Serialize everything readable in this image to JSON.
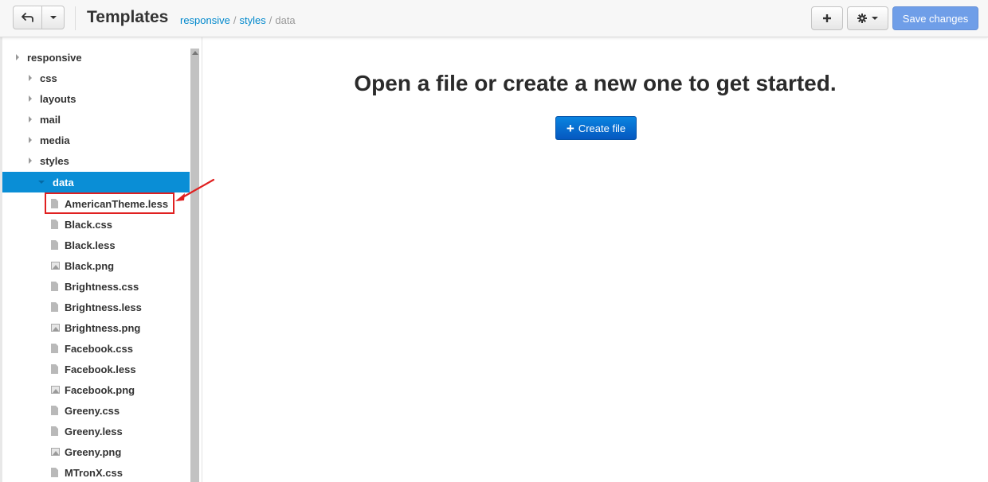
{
  "header": {
    "title": "Templates",
    "breadcrumb": [
      "responsive",
      "styles",
      "data"
    ],
    "breadcrumb_separator": "/",
    "save_label": "Save changes",
    "icons": {
      "back": "back-arrow-icon",
      "back_menu": "chevron-down-icon",
      "add": "plus-icon",
      "settings": "gear-icon",
      "settings_menu": "chevron-down-icon"
    }
  },
  "sidebar": {
    "tree": [
      {
        "label": "responsive",
        "type": "folder",
        "expanded": false
      },
      {
        "label": "css",
        "type": "folder",
        "expanded": false
      },
      {
        "label": "layouts",
        "type": "folder",
        "expanded": false
      },
      {
        "label": "mail",
        "type": "folder",
        "expanded": false
      },
      {
        "label": "media",
        "type": "folder",
        "expanded": false
      },
      {
        "label": "styles",
        "type": "folder",
        "expanded": false
      },
      {
        "label": "data",
        "type": "folder",
        "expanded": true,
        "selected": true
      },
      {
        "label": "AmericanTheme.less",
        "type": "file",
        "highlighted": true
      },
      {
        "label": "Black.css",
        "type": "file"
      },
      {
        "label": "Black.less",
        "type": "file"
      },
      {
        "label": "Black.png",
        "type": "image"
      },
      {
        "label": "Brightness.css",
        "type": "file"
      },
      {
        "label": "Brightness.less",
        "type": "file"
      },
      {
        "label": "Brightness.png",
        "type": "image"
      },
      {
        "label": "Facebook.css",
        "type": "file"
      },
      {
        "label": "Facebook.less",
        "type": "file"
      },
      {
        "label": "Facebook.png",
        "type": "image"
      },
      {
        "label": "Greeny.css",
        "type": "file"
      },
      {
        "label": "Greeny.less",
        "type": "file"
      },
      {
        "label": "Greeny.png",
        "type": "image"
      },
      {
        "label": "MTronX.css",
        "type": "file"
      }
    ]
  },
  "main": {
    "message": "Open a file or create a new one to get started.",
    "create_label": "Create file"
  },
  "colors": {
    "accent": "#0a8ed6",
    "link": "#0088cc",
    "save_button": "#6f9ee8",
    "create_button": "#0558c0",
    "annotation": "#e02020"
  }
}
